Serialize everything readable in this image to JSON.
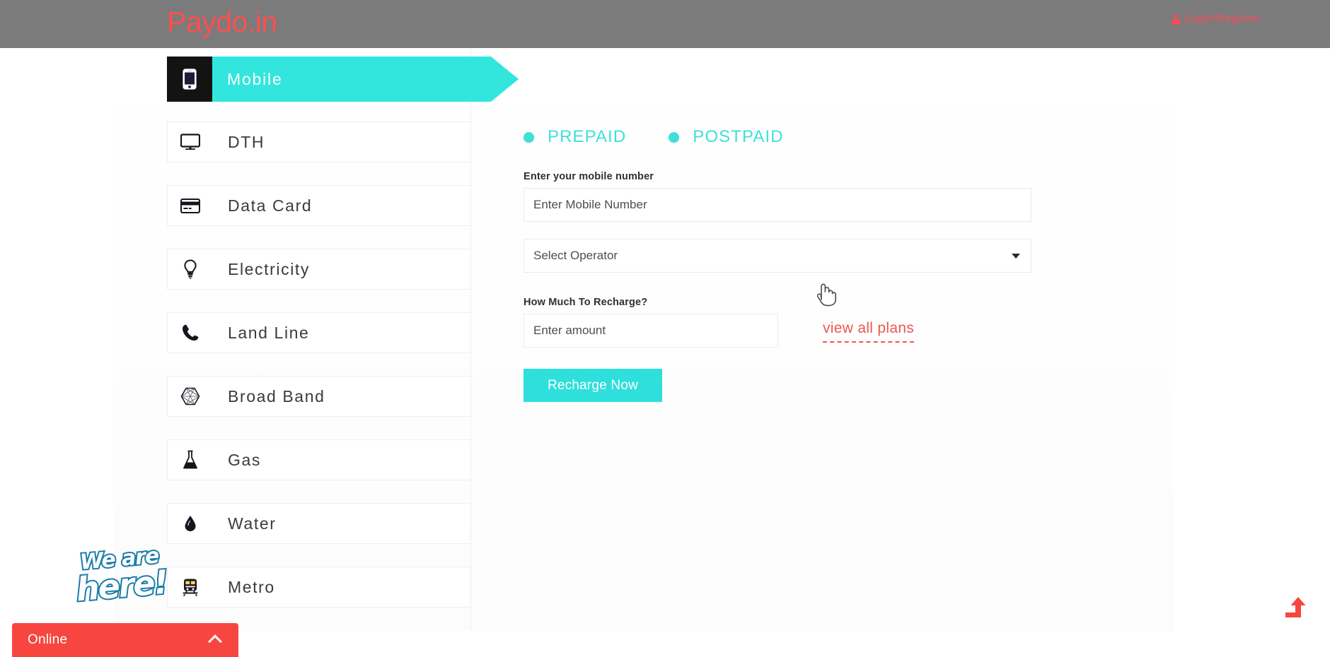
{
  "header": {
    "logo": "Paydo.in",
    "login_label": "Login/Register",
    "login_icon": "user-icon",
    "bg_color": "#7b7b7b",
    "accent_red": "#fc4f4f"
  },
  "sidebar": {
    "items": [
      {
        "label": "Mobile",
        "icon": "mobile-phone-icon",
        "active": true
      },
      {
        "label": "DTH",
        "icon": "tv-monitor-icon",
        "active": false
      },
      {
        "label": "Data Card",
        "icon": "credit-card-icon",
        "active": false
      },
      {
        "label": "Electricity",
        "icon": "lightbulb-icon",
        "active": false
      },
      {
        "label": "Land Line",
        "icon": "phone-handset-icon",
        "active": false
      },
      {
        "label": "Broad Band",
        "icon": "hexagon-mesh-icon",
        "active": false
      },
      {
        "label": "Gas",
        "icon": "flask-icon",
        "active": false
      },
      {
        "label": "Water",
        "icon": "water-drop-icon",
        "active": false
      },
      {
        "label": "Metro",
        "icon": "metro-train-icon",
        "active": false
      }
    ],
    "active_bg_color": "#32e6de",
    "active_icon_bg": "#131313"
  },
  "form": {
    "plan_types": [
      {
        "label": "PREPAID",
        "selected": true
      },
      {
        "label": "POSTPAID",
        "selected": true
      }
    ],
    "mobile_label": "Enter your mobile number",
    "mobile_placeholder": "Enter Mobile Number",
    "mobile_value": "",
    "operator_selected": "Select Operator",
    "operator_options": [
      "Select Operator"
    ],
    "amount_label": "How Much To Recharge?",
    "amount_placeholder": "Enter amount",
    "amount_value": "",
    "view_plans_label": "view all plans",
    "view_plans_color": "#f0564f",
    "recharge_label": "Recharge Now",
    "recharge_bg": "#2fdfdb",
    "accent_cyan": "#3ee0da"
  },
  "overlays": {
    "badge_line1": "We are",
    "badge_line2": "here!",
    "badge_outline_color": "#1c7ca8",
    "chat_status": "Online",
    "chat_bg": "#f7463f",
    "chat_chevron_icon": "chevron-up-icon",
    "scroll_top_icon": "arrow-up-turn-icon",
    "scroll_top_color": "#f7463f",
    "cursor_icon": "pointer-hand-cursor"
  }
}
